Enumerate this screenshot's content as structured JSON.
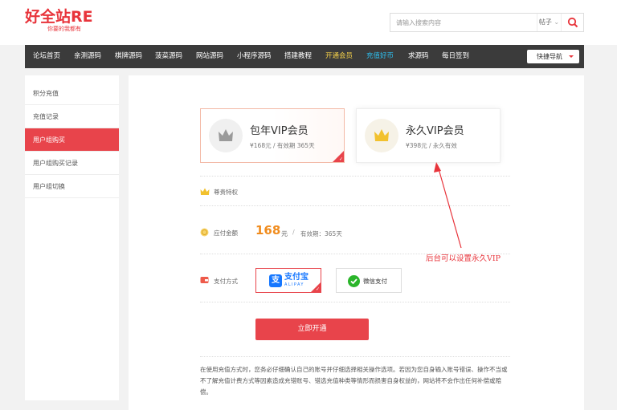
{
  "header": {
    "logo_title": "好全站RE",
    "logo_subtitle": "你要的我都有",
    "search_placeholder": "请输入搜索内容",
    "search_type": "帖子",
    "search_type_caret": "⌄"
  },
  "nav": {
    "items": [
      {
        "label": "论坛首页"
      },
      {
        "label": "亲测源码"
      },
      {
        "label": "棋牌源码"
      },
      {
        "label": "菠菜源码"
      },
      {
        "label": "网站源码"
      },
      {
        "label": "小程序源码"
      },
      {
        "label": "搭建教程"
      },
      {
        "label": "开通会员"
      },
      {
        "label": "充值好币"
      },
      {
        "label": "求源码"
      },
      {
        "label": "每日签到"
      }
    ],
    "quick_nav": "快捷导航"
  },
  "sidebar": {
    "items": [
      {
        "label": "积分充值"
      },
      {
        "label": "充值记录"
      },
      {
        "label": "用户组购买"
      },
      {
        "label": "用户组购买记录"
      },
      {
        "label": "用户组切换"
      }
    ],
    "active_index": 2
  },
  "vip_cards": [
    {
      "name": "包年VIP会员",
      "desc": "¥168元 / 有效期 365天",
      "selected": true
    },
    {
      "name": "永久VIP会员",
      "desc": "¥398元 / 永久有效",
      "selected": false
    }
  ],
  "privilege_label": "尊贵特权",
  "payment": {
    "amount_label": "应付金额",
    "amount": "168",
    "unit": "元",
    "separator": "/",
    "period": "有效期：365天",
    "method_label": "支付方式",
    "alipay_text": "支付宝",
    "alipay_sub": "ALIPAY",
    "alipay_glyph": "支",
    "wechat_text": "微信支付",
    "submit": "立即开通"
  },
  "notice": "在使用充值方式时，您务必仔细确认自己的账号并仔细选择相关操作选项。若因为您自身输入账号错误、操作不当或不了解充值计费方式等因素造成充错账号、错选充值种类等情形而损害自身权益的，网站将不会作出任何补偿或赔偿。",
  "annotation": "后台可以设置永久VIP",
  "colors": {
    "brand_red": "#e8343b",
    "nav_bg": "#3b3b3b",
    "price_orange": "#f08c1e",
    "gold": "#f2c12e"
  }
}
